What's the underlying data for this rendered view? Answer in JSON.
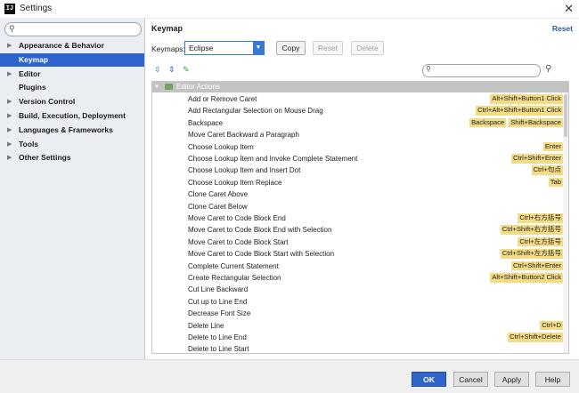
{
  "window": {
    "title": "Settings",
    "app_icon_text": "IJ"
  },
  "sidebar": {
    "search_value": "",
    "items": [
      {
        "label": "Appearance & Behavior",
        "expandable": true
      },
      {
        "label": "Keymap",
        "expandable": false,
        "selected": true
      },
      {
        "label": "Editor",
        "expandable": true
      },
      {
        "label": "Plugins",
        "expandable": false
      },
      {
        "label": "Version Control",
        "expandable": true
      },
      {
        "label": "Build, Execution, Deployment",
        "expandable": true
      },
      {
        "label": "Languages & Frameworks",
        "expandable": true
      },
      {
        "label": "Tools",
        "expandable": true
      },
      {
        "label": "Other Settings",
        "expandable": true
      }
    ]
  },
  "keymap": {
    "title": "Keymap",
    "reset_link": "Reset",
    "keymaps_label": "Keymaps:",
    "selected_keymap": "Eclipse",
    "copy_label": "Copy",
    "reset_label": "Reset",
    "delete_label": "Delete",
    "filter_value": "",
    "group_label": "Editor Actions",
    "actions": [
      {
        "name": "Add or Remove Caret",
        "shortcuts": [
          "Alt+Shift+Button1 Click"
        ]
      },
      {
        "name": "Add Rectangular Selection on Mouse Drag",
        "shortcuts": [
          "Ctrl+Alt+Shift+Button1 Click"
        ]
      },
      {
        "name": "Backspace",
        "shortcuts": [
          "Backspace",
          "Shift+Backspace"
        ]
      },
      {
        "name": "Move Caret Backward a Paragraph",
        "shortcuts": []
      },
      {
        "name": "Choose Lookup Item",
        "shortcuts": [
          "Enter"
        ]
      },
      {
        "name": "Choose Lookup Item and Invoke Complete Statement",
        "shortcuts": [
          "Ctrl+Shift+Enter"
        ]
      },
      {
        "name": "Choose Lookup Item and Insert Dot",
        "shortcuts": [
          "Ctrl+句点"
        ]
      },
      {
        "name": "Choose Lookup Item Replace",
        "shortcuts": [
          "Tab"
        ]
      },
      {
        "name": "Clone Caret Above",
        "shortcuts": []
      },
      {
        "name": "Clone Caret Below",
        "shortcuts": []
      },
      {
        "name": "Move Caret to Code Block End",
        "shortcuts": [
          "Ctrl+右方括号"
        ]
      },
      {
        "name": "Move Caret to Code Block End with Selection",
        "shortcuts": [
          "Ctrl+Shift+右方括号"
        ]
      },
      {
        "name": "Move Caret to Code Block Start",
        "shortcuts": [
          "Ctrl+左方括号"
        ]
      },
      {
        "name": "Move Caret to Code Block Start with Selection",
        "shortcuts": [
          "Ctrl+Shift+左方括号"
        ]
      },
      {
        "name": "Complete Current Statement",
        "shortcuts": [
          "Ctrl+Shift+Enter"
        ]
      },
      {
        "name": "Create Rectangular Selection",
        "shortcuts": [
          "Alt+Shift+Button2 Click"
        ]
      },
      {
        "name": "Cut Line Backward",
        "shortcuts": []
      },
      {
        "name": "Cut up to Line End",
        "shortcuts": []
      },
      {
        "name": "Decrease Font Size",
        "shortcuts": []
      },
      {
        "name": "Delete Line",
        "shortcuts": [
          "Ctrl+D"
        ]
      },
      {
        "name": "Delete to Line End",
        "shortcuts": [
          "Ctrl+Shift+Delete"
        ]
      },
      {
        "name": "Delete to Line Start",
        "shortcuts": []
      }
    ]
  },
  "footer": {
    "ok": "OK",
    "cancel": "Cancel",
    "apply": "Apply",
    "help": "Help"
  }
}
